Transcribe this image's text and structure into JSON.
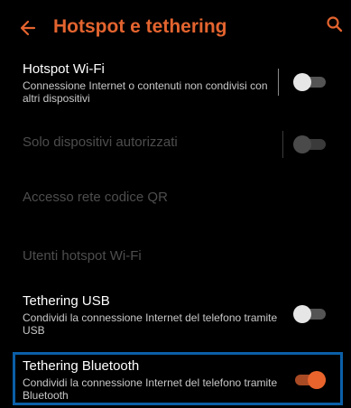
{
  "header": {
    "title": "Hotspot e tethering",
    "back_icon": "arrow-left-icon",
    "search_icon": "search-icon",
    "accent_color": "#e4642f"
  },
  "settings": [
    {
      "title": "Hotspot Wi-Fi",
      "subtitle": "Connessione Internet o contenuti non condivisi con altri dispositivi",
      "toggle": "off",
      "enabled": true
    },
    {
      "title": "Solo dispositivi autorizzati",
      "toggle": "off",
      "enabled": false
    },
    {
      "title": "Accesso rete codice QR",
      "enabled": false
    },
    {
      "title": "Utenti hotspot Wi-Fi",
      "enabled": false
    },
    {
      "title": "Tethering USB",
      "subtitle": "Condividi la connessione Internet del telefono tramite USB",
      "toggle": "off",
      "enabled": true
    },
    {
      "title": "Tethering Bluetooth",
      "subtitle": "Condividi la connessione Internet del telefono tramite Bluetooth",
      "toggle": "on",
      "enabled": true,
      "highlighted": true,
      "highlight_color": "#0b5fa8"
    }
  ]
}
